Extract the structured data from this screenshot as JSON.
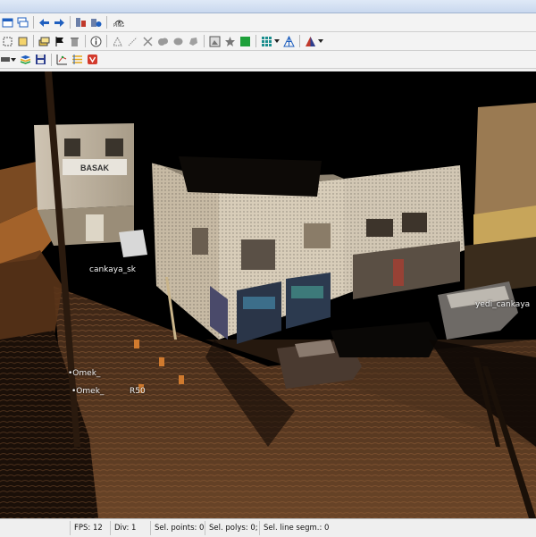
{
  "toolbar": {
    "ping_label": "PING"
  },
  "viewport": {
    "labels": {
      "cankaya_sk": "cankaya_sk",
      "yedikcankaya": "yedi_cankaya",
      "omek1": "•Omek_",
      "omek2": "•Omek_",
      "omek_suffix": "R50"
    },
    "signs": {
      "shop_sign": "BASAK"
    }
  },
  "status": {
    "fps": "FPS: 12",
    "div": "Div: 1",
    "sel_points": "Sel. points: 0;",
    "sel_polys": "Sel. polys: 0;",
    "sel_line_segm": "Sel. line segm.: 0"
  },
  "colors": {
    "background": "#000000",
    "toolbar": "#f3f3f3",
    "accent_blue": "#1f5fbf",
    "accent_green": "#1ea03a"
  }
}
